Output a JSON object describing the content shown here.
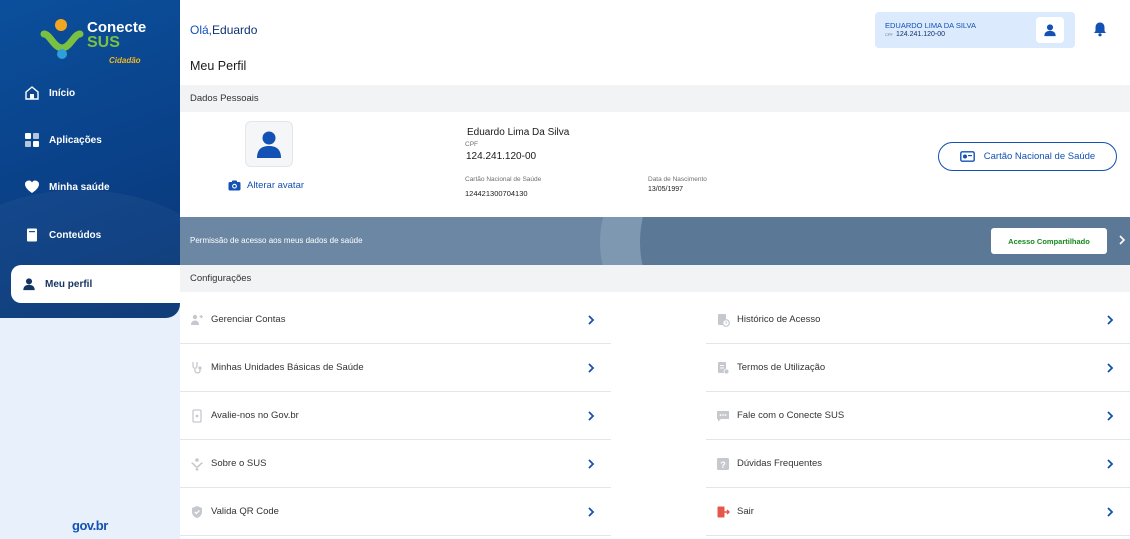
{
  "brand": {
    "line1": "Conecte",
    "line2": "SUS",
    "line3": "Cidadão",
    "footer": "gov.br"
  },
  "colors": {
    "primary": "#1351b4",
    "sidebar": "#0b4f9c",
    "banner": "#5b7896",
    "green": "#168821"
  },
  "sidebar": {
    "items": [
      {
        "label": "Início",
        "icon": "home-icon"
      },
      {
        "label": "Aplicações",
        "icon": "grid-icon"
      },
      {
        "label": "Minha saúde",
        "icon": "heart-icon"
      },
      {
        "label": "Conteúdos",
        "icon": "book-icon"
      },
      {
        "label": "Meu perfil",
        "icon": "person-icon",
        "active": true
      }
    ]
  },
  "header": {
    "greeting_prefix": "Olá,",
    "greeting_name": "Eduardo",
    "user_name": "EDUARDO LIMA DA SILVA",
    "cpf_label": "CPF",
    "cpf": "124.241.120-00"
  },
  "page": {
    "title": "Meu Perfil"
  },
  "personal": {
    "section_title": "Dados Pessoais",
    "change_avatar": "Alterar avatar",
    "name": "Eduardo Lima Da Silva",
    "cpf_label": "CPF",
    "cpf": "124.241.120-00",
    "cns_label": "Cartão Nacional de Saúde",
    "cns": "124421300704130",
    "birth_label": "Data de Nascimento",
    "birth": "13/05/1997",
    "card_button": "Cartão Nacional de Saúde"
  },
  "banner": {
    "text": "Permissão de acesso aos meus dados de saúde",
    "button": "Acesso Compartilhado"
  },
  "settings": {
    "section_title": "Configurações",
    "left": [
      {
        "label": "Gerenciar Contas",
        "icon": "accounts-icon"
      },
      {
        "label": "Minhas Unidades Básicas de Saúde",
        "icon": "stethoscope-icon"
      },
      {
        "label": "Avalie-nos no Gov.br",
        "icon": "phone-icon"
      },
      {
        "label": "Sobre o SUS",
        "icon": "sus-icon"
      },
      {
        "label": "Valida QR Code",
        "icon": "shield-icon"
      }
    ],
    "right": [
      {
        "label": "Histórico de Acesso",
        "icon": "history-icon"
      },
      {
        "label": "Termos de Utilização",
        "icon": "document-icon"
      },
      {
        "label": "Fale com o Conecte SUS",
        "icon": "chat-icon"
      },
      {
        "label": "Dúvidas Frequentes",
        "icon": "question-icon"
      },
      {
        "label": "Sair",
        "icon": "logout-icon"
      }
    ]
  }
}
